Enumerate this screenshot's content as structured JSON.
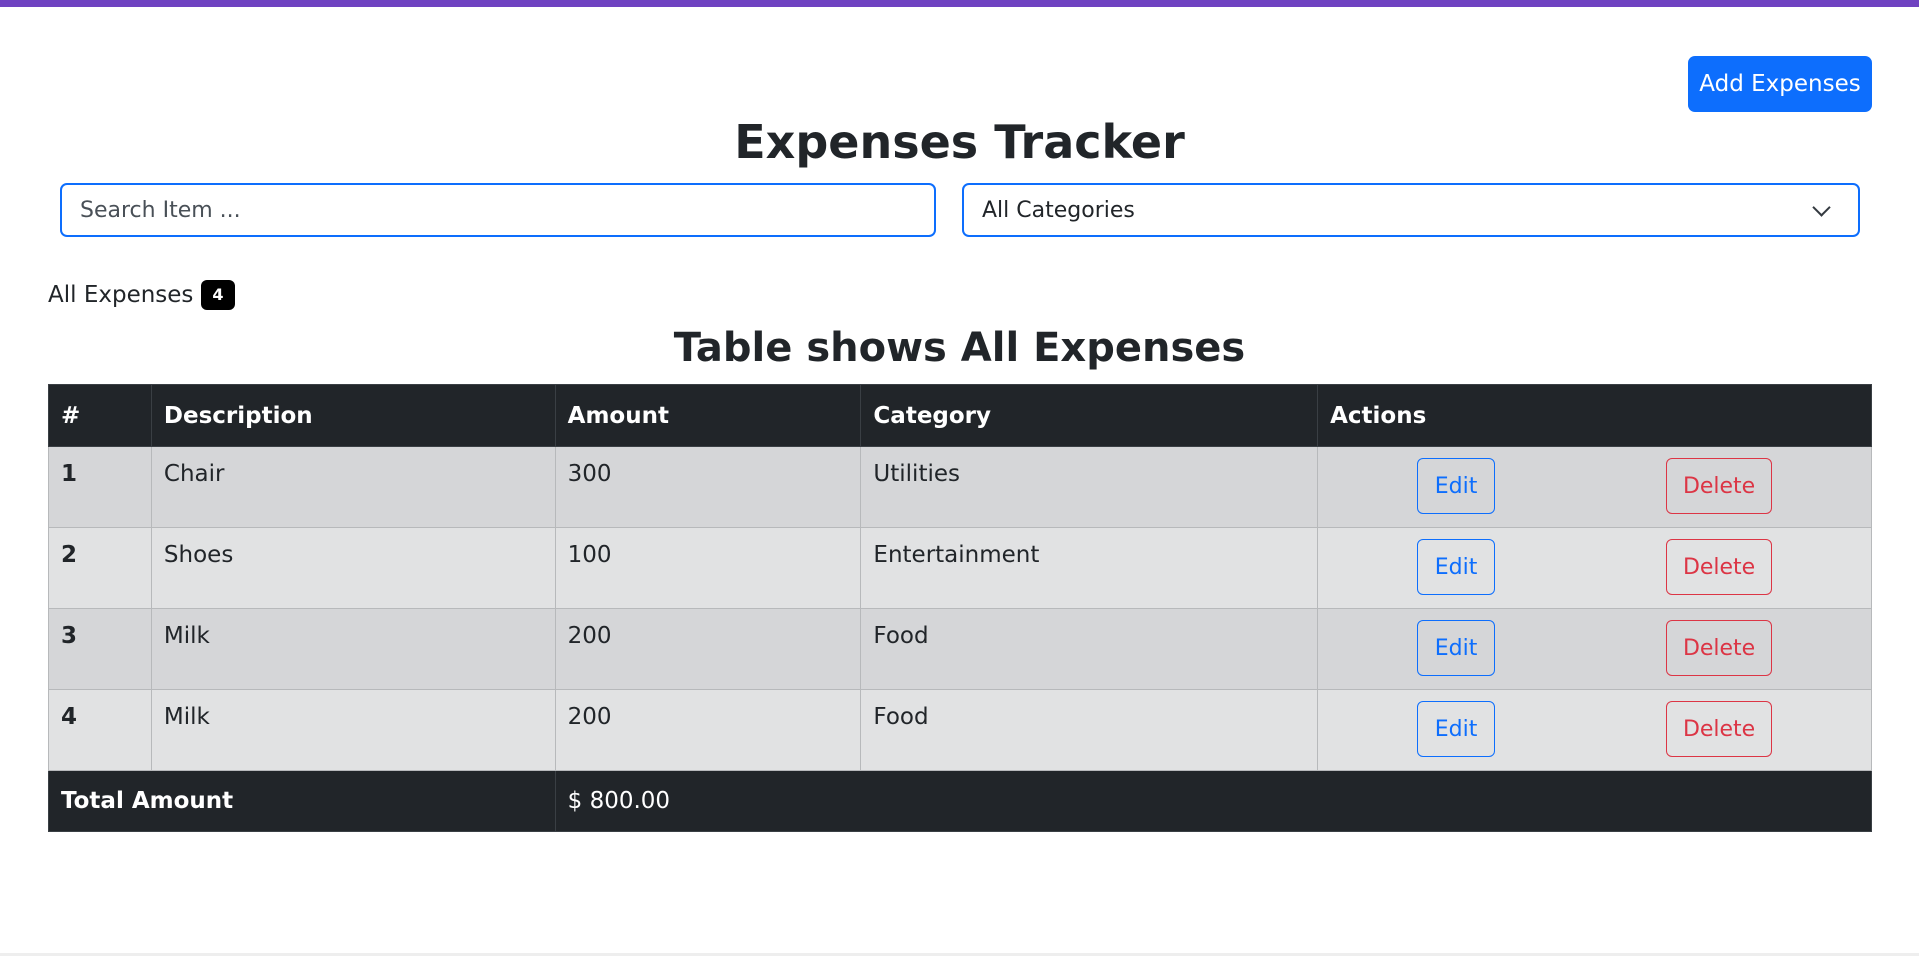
{
  "header": {
    "add_button_label": "Add Expenses",
    "title": "Expenses Tracker"
  },
  "filters": {
    "search_placeholder": "Search Item ...",
    "category_selected": "All Categories"
  },
  "summary": {
    "label": "All Expenses",
    "count": "4"
  },
  "table": {
    "caption": "Table shows All Expenses",
    "columns": [
      "#",
      "Description",
      "Amount",
      "Category",
      "Actions"
    ],
    "rows": [
      {
        "index": "1",
        "description": "Chair",
        "amount": "300",
        "category": "Utilities"
      },
      {
        "index": "2",
        "description": "Shoes",
        "amount": "100",
        "category": "Entertainment"
      },
      {
        "index": "3",
        "description": "Milk",
        "amount": "200",
        "category": "Food"
      },
      {
        "index": "4",
        "description": "Milk",
        "amount": "200",
        "category": "Food"
      }
    ],
    "edit_label": "Edit",
    "delete_label": "Delete",
    "footer": {
      "label": "Total Amount",
      "value": "$ 800.00"
    }
  },
  "colors": {
    "accent": "#0d6efd",
    "danger": "#dc3545",
    "dark": "#212529",
    "top_bar": "#6f42c1"
  }
}
